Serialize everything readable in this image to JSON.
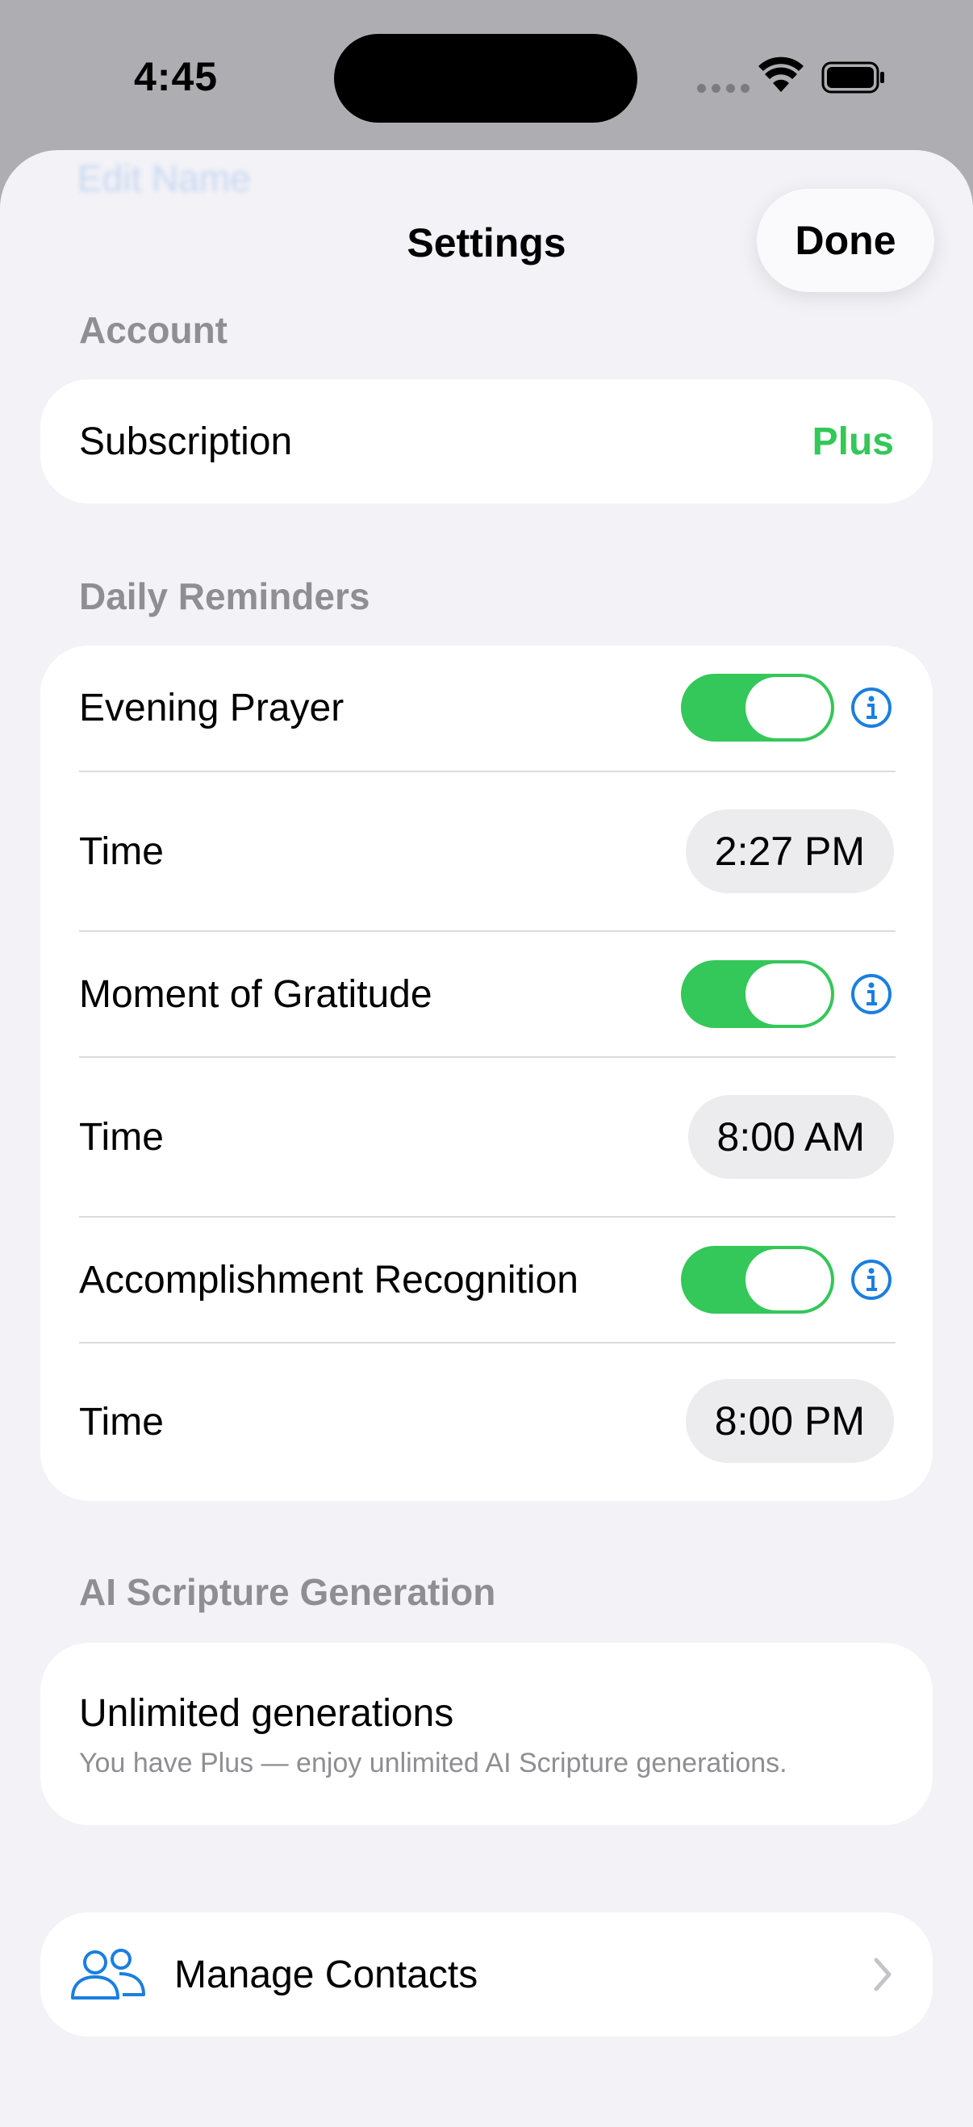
{
  "status_bar": {
    "time": "4:45"
  },
  "header": {
    "ghost_title": "Edit Name",
    "title": "Settings",
    "done_label": "Done"
  },
  "account": {
    "label": "Account",
    "subscription_label": "Subscription",
    "subscription_value": "Plus"
  },
  "reminders": {
    "label": "Daily Reminders",
    "items": [
      {
        "name": "Evening Prayer",
        "enabled": true,
        "time_label": "Time",
        "time": "2:27 PM"
      },
      {
        "name": "Moment of Gratitude",
        "enabled": true,
        "time_label": "Time",
        "time": "8:00 AM"
      },
      {
        "name": "Accomplishment Recognition",
        "enabled": true,
        "time_label": "Time",
        "time": "8:00 PM"
      }
    ]
  },
  "ai": {
    "label": "AI Scripture Generation",
    "title": "Unlimited generations",
    "subtitle": "You have Plus — enjoy unlimited AI Scripture generations."
  },
  "contacts": {
    "label": "Manage Contacts"
  },
  "colors": {
    "accent_green": "#34c759",
    "info_blue": "#1a7fe0"
  }
}
